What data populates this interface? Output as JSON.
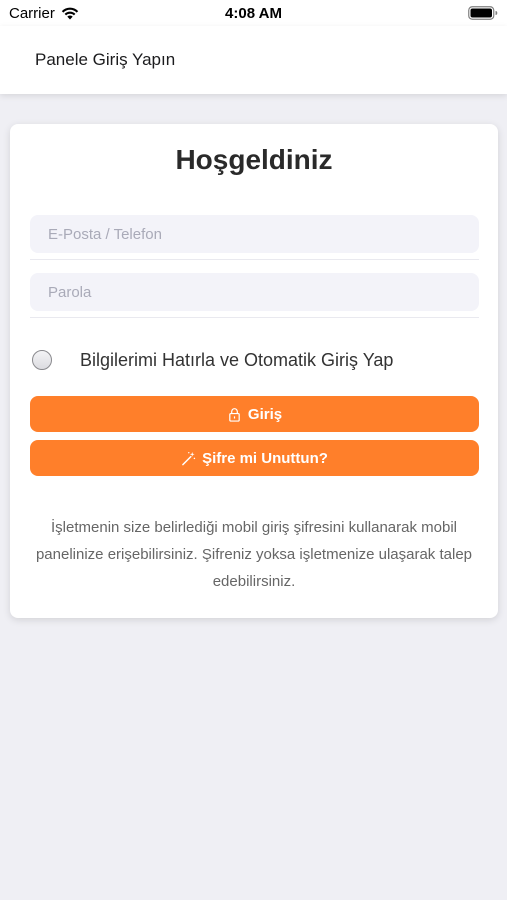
{
  "status_bar": {
    "carrier": "Carrier",
    "time": "4:08 AM",
    "wifi_icon": "wifi-icon",
    "battery_icon": "battery-icon"
  },
  "nav": {
    "title": "Panele Giriş Yapın"
  },
  "card": {
    "title": "Hoşgeldiniz",
    "email_placeholder": "E-Posta / Telefon",
    "email_value": "",
    "password_placeholder": "Parola",
    "password_value": "",
    "remember_label": "Bilgilerimi Hatırla ve Otomatik Giriş Yap",
    "remember_checked": false,
    "login_button": {
      "label": "Giriş",
      "icon": "lock-icon"
    },
    "forgot_button": {
      "label": "Şifre mi Unuttun?",
      "icon": "magic-wand-icon"
    },
    "info_text": "İşletmenin size belirlediği mobil giriş şifresini kullanarak mobil panelinize erişebilirsiniz. Şifreniz yoksa işletmenize ulaşarak talep edebilirsiniz."
  },
  "colors": {
    "accent": "#ff7f2a",
    "background": "#efeff4",
    "input_bg": "#f3f3f9"
  }
}
